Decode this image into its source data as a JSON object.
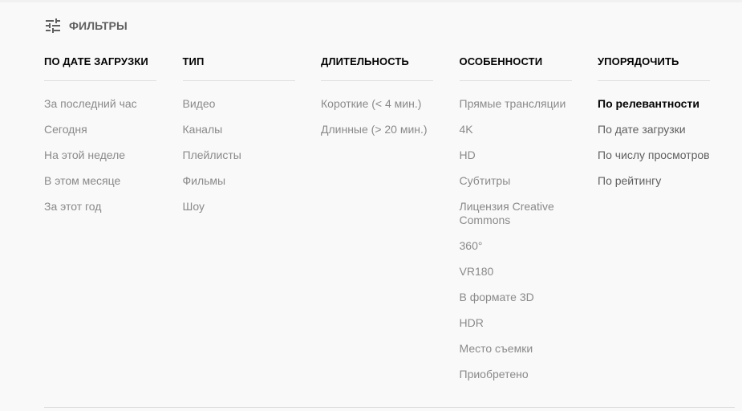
{
  "filter_toggle": {
    "icon": "tune-icon",
    "label": "ФИЛЬТРЫ"
  },
  "groups": [
    {
      "header": "ПО ДАТЕ ЗАГРУЗКИ",
      "items": [
        {
          "label": "За последний час"
        },
        {
          "label": "Сегодня"
        },
        {
          "label": "На этой неделе"
        },
        {
          "label": "В этом месяце"
        },
        {
          "label": "За этот год"
        }
      ]
    },
    {
      "header": "ТИП",
      "items": [
        {
          "label": "Видео"
        },
        {
          "label": "Каналы"
        },
        {
          "label": "Плейлисты"
        },
        {
          "label": "Фильмы"
        },
        {
          "label": "Шоу"
        }
      ]
    },
    {
      "header": "ДЛИТЕЛЬНОСТЬ",
      "items": [
        {
          "label": "Короткие (< 4 мин.)"
        },
        {
          "label": "Длинные (> 20 мин.)"
        }
      ]
    },
    {
      "header": "ОСОБЕННОСТИ",
      "items": [
        {
          "label": "Прямые трансляции"
        },
        {
          "label": "4K"
        },
        {
          "label": "HD"
        },
        {
          "label": "Субтитры"
        },
        {
          "label": "Лицензия Creative Commons"
        },
        {
          "label": "360°"
        },
        {
          "label": "VR180"
        },
        {
          "label": "В формате 3D"
        },
        {
          "label": "HDR"
        },
        {
          "label": "Место съемки"
        },
        {
          "label": "Приобретено"
        }
      ]
    },
    {
      "header": "УПОРЯДОЧИТЬ",
      "items": [
        {
          "label": "По релевантности",
          "selected": true
        },
        {
          "label": "По дате загрузки"
        },
        {
          "label": "По числу просмотров"
        },
        {
          "label": "По рейтингу"
        }
      ]
    }
  ]
}
